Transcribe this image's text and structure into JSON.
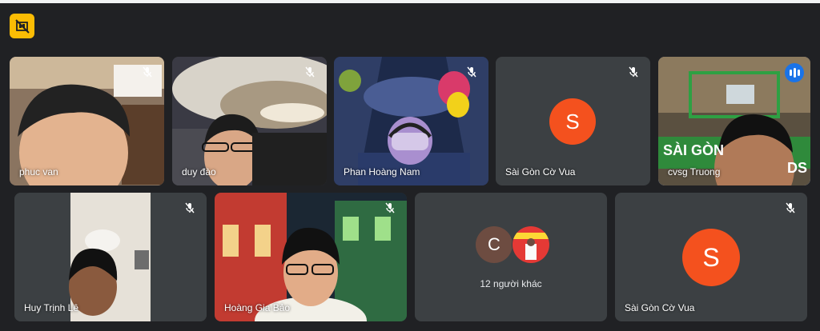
{
  "meeting": {
    "badge_icon": "presentation-off-icon",
    "accent_color": "#fbbc04"
  },
  "participants": [
    {
      "name": "phuc van",
      "muted": true
    },
    {
      "name": "duy đào",
      "muted": true
    },
    {
      "name": "Phan Hoàng Nam",
      "muted": true
    },
    {
      "name": "Sài Gòn Cờ Vua",
      "muted": true,
      "avatar_letter": "S",
      "avatar_color": "#f4511e"
    },
    {
      "name": "cvsg Truong",
      "muted": false,
      "speaking": true,
      "overlay_text": "SÀI GÒN",
      "overlay_text_2": "DS"
    },
    {
      "name": "Huy Trịnh Lê",
      "muted": true
    },
    {
      "name": "Hoàng Gia Bảo",
      "muted": true
    },
    {
      "name": "Sài Gòn Cờ Vua",
      "muted": true,
      "avatar_letter": "S",
      "avatar_color": "#f4511e"
    }
  ],
  "others": {
    "label": "12 người khác",
    "avatar_letter": "C"
  }
}
